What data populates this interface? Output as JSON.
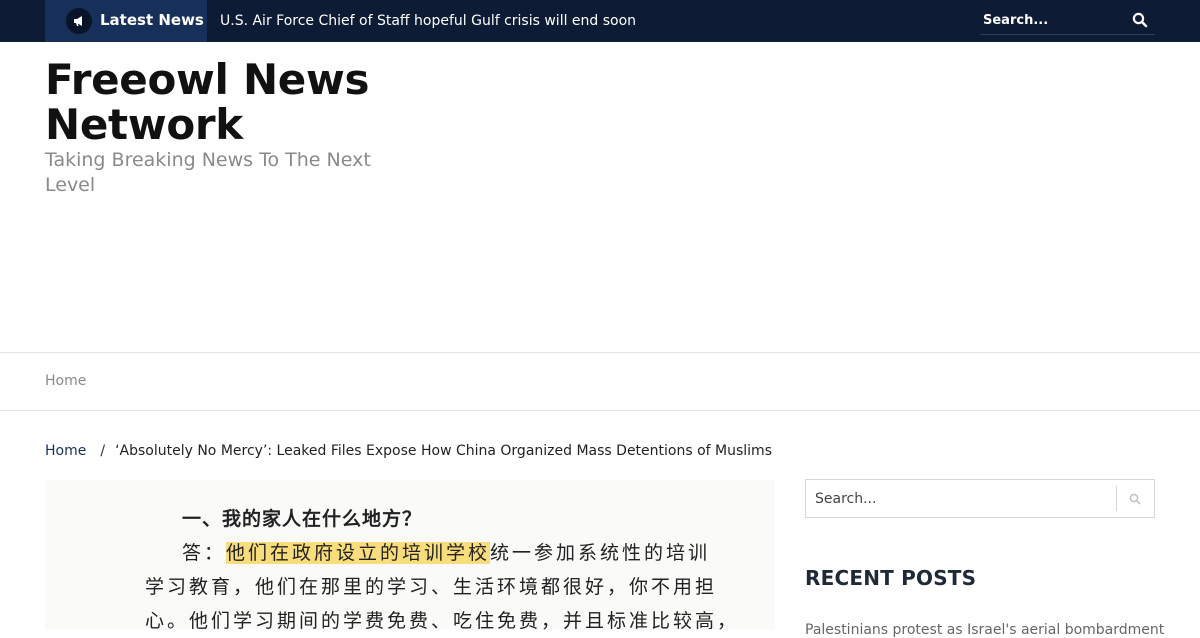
{
  "topbar": {
    "latest_label": "Latest News",
    "ticker_text": "U.S. Air Force Chief of Staff hopeful Gulf crisis will end soon",
    "search_placeholder": "Search..."
  },
  "branding": {
    "site_title": "Freeowl News Network",
    "tagline": "Taking Breaking News To The Next Level"
  },
  "nav": {
    "items": [
      "Home"
    ]
  },
  "breadcrumb": {
    "home": "Home",
    "separator": "/",
    "current": "‘Absolutely No Mercy’: Leaked Files Expose How China Organized Mass Detentions of Muslims"
  },
  "article_image": {
    "heading": "一、我的家人在什么地方？",
    "answer_prefix": "答：",
    "highlighted": "他们在政府设立的培训学校",
    "line1_rest": "统一参加系统性的培训",
    "line2": "学习教育，他们在那里的学习、生活环境都很好，你不用担",
    "line3": "心。他们学习期间的学费免费、吃住免费，并且标准比较高，"
  },
  "sidebar": {
    "search_placeholder": "Search...",
    "recent_posts_title": "RECENT POSTS",
    "recent_first": "Palestinians protest as Israel's aerial bombardment"
  },
  "colors": {
    "topbar_bg": "#0d1b34",
    "latest_bg": "#17305a",
    "highlight": "#f9dc7b"
  }
}
